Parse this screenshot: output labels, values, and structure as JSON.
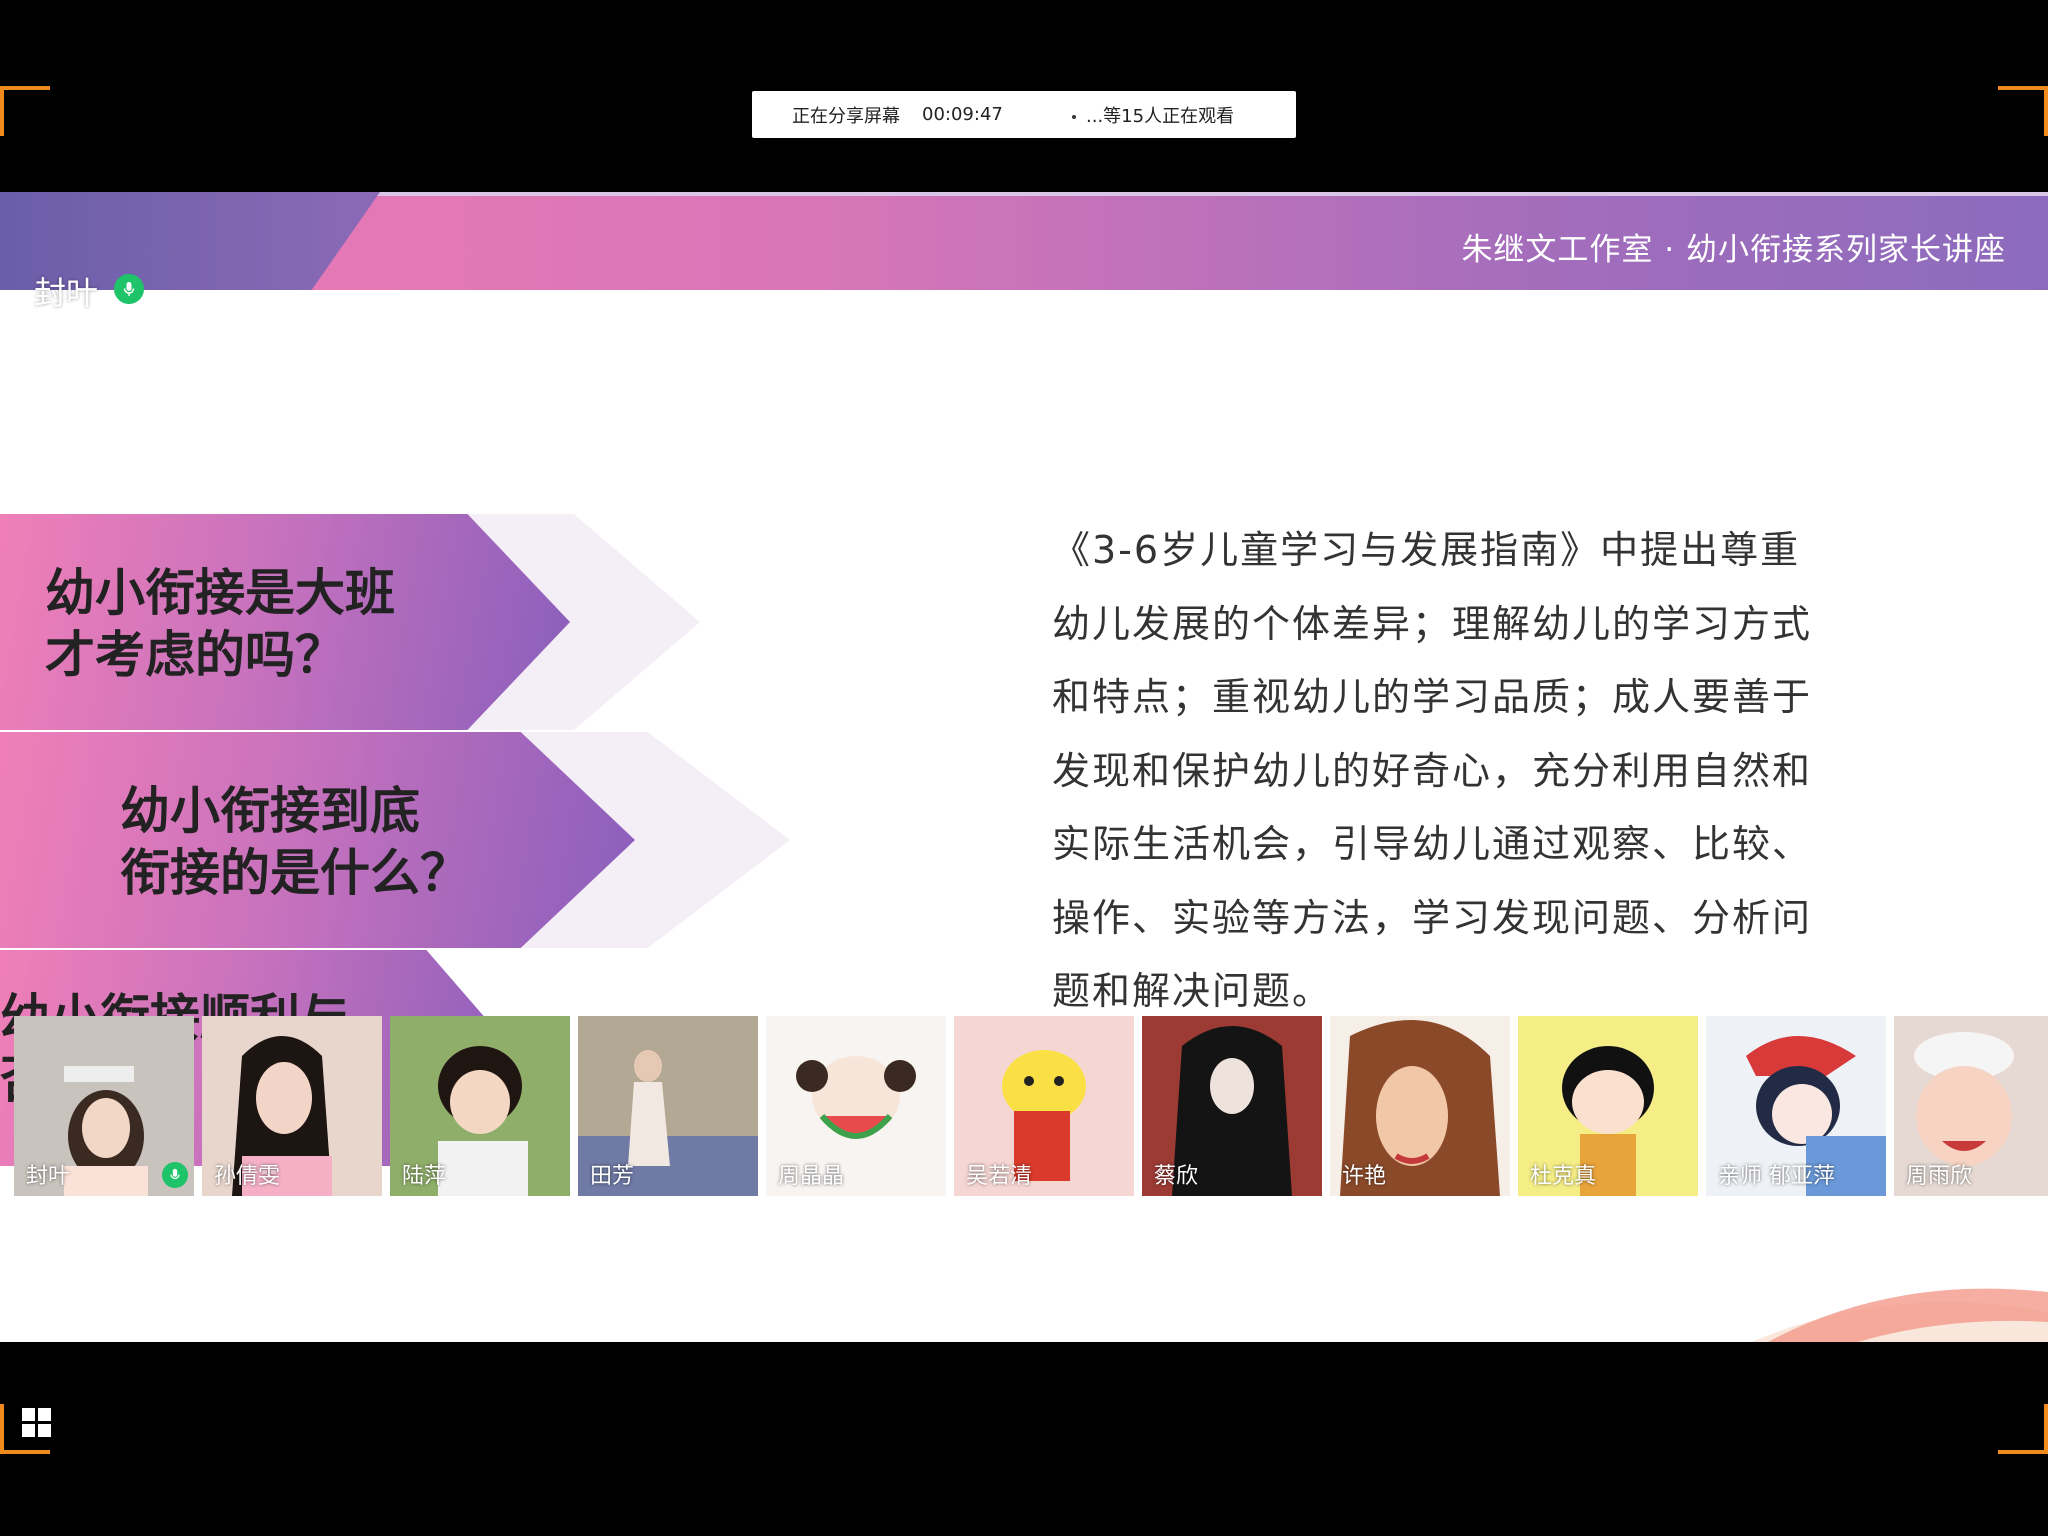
{
  "share_bar": {
    "status": "正在分享屏幕",
    "timer": "00:09:47",
    "viewers": "...等15人正在观看"
  },
  "slide": {
    "header_title": "朱继文工作室 · 幼小衔接系列家长讲座",
    "arrows": [
      {
        "line1": "幼小衔接是大班",
        "line2": "才考虑的吗？"
      },
      {
        "line1": "幼小衔接到底",
        "line2": "衔接的是什么？"
      },
      {
        "line1": "幼小衔接顺利与",
        "line2": "否"
      }
    ],
    "body_lines": [
      "《3-6岁儿童学习与发展指南》中提出尊重",
      "幼儿发展的个体差异；理解幼儿的学习方式",
      "和特点；重视幼儿的学习品质；成人要善于",
      "发现和保护幼儿的好奇心，充分利用自然和",
      "实际生活机会，引导幼儿通过观察、比较、",
      "操作、实验等方法，学习发现问题、分析问",
      "题和解决问题。"
    ]
  },
  "presenter": {
    "name": "封叶"
  },
  "participants": [
    {
      "name": "封叶",
      "mic": true,
      "bg": "#c9c3bd"
    },
    {
      "name": "孙倩雯",
      "mic": false,
      "bg": "#e6cfc2"
    },
    {
      "name": "陆萍",
      "mic": false,
      "bg": "#8fae6a"
    },
    {
      "name": "田芳",
      "mic": false,
      "bg": "#a59a86"
    },
    {
      "name": "周晶晶",
      "mic": false,
      "bg": "#f7f4f2"
    },
    {
      "name": "吴若清",
      "mic": false,
      "bg": "#f6d6d2"
    },
    {
      "name": "蔡欣",
      "mic": false,
      "bg": "#9c3a34"
    },
    {
      "name": "许艳",
      "mic": false,
      "bg": "#c27a55"
    },
    {
      "name": "杜克真",
      "mic": false,
      "bg": "#f5ee86"
    },
    {
      "name": "亲师 郁亚萍",
      "mic": false,
      "bg": "#eef1f6"
    },
    {
      "name": "周雨欣",
      "mic": false,
      "bg": "#e6d9d3"
    }
  ]
}
